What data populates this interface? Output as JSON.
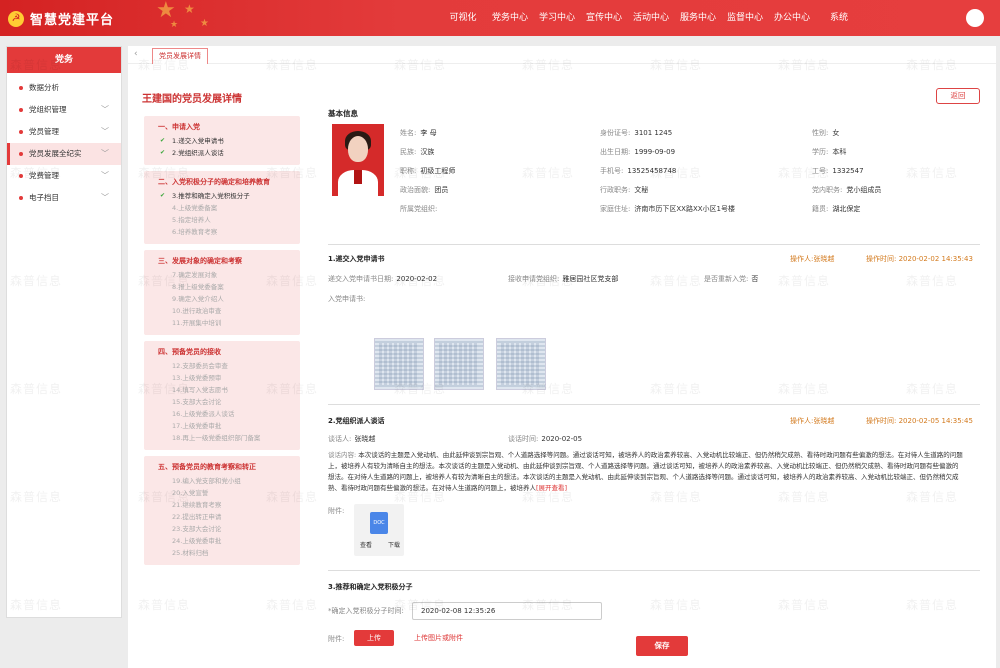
{
  "brand": {
    "title": "智慧党建平台"
  },
  "nav": [
    "可视化",
    "党务中心",
    "学习中心",
    "宣传中心",
    "活动中心",
    "服务中心",
    "监督中心",
    "办公中心",
    "系统"
  ],
  "sidebar": {
    "header": "党务",
    "items": [
      {
        "label": "数据分析",
        "active": false
      },
      {
        "label": "党组织管理",
        "active": false
      },
      {
        "label": "党员管理",
        "active": false
      },
      {
        "label": "党员发展全纪实",
        "active": true
      },
      {
        "label": "党费管理",
        "active": false
      },
      {
        "label": "电子档目",
        "active": false
      }
    ]
  },
  "tab": {
    "label": "党员发展详情"
  },
  "page": {
    "title": "王建国的党员发展详情",
    "back_label": "返回"
  },
  "steps": [
    {
      "title": "一、申请入党",
      "items": [
        {
          "label": "1.递交入党申请书",
          "done": true
        },
        {
          "label": "2.党组织派人谈话",
          "done": true
        }
      ]
    },
    {
      "title": "二、入党积极分子的确定和培养教育",
      "items": [
        {
          "label": "3.推荐和确定入党积极分子",
          "done": true
        },
        {
          "label": "4.上级党委备案",
          "done": false
        },
        {
          "label": "5.指定培养人",
          "done": false
        },
        {
          "label": "6.培养教育考察",
          "done": false
        }
      ]
    },
    {
      "title": "三、发展对象的确定和考察",
      "items": [
        {
          "label": "7.确定发展对象",
          "done": false
        },
        {
          "label": "8.报上级党委备案",
          "done": false
        },
        {
          "label": "9.确定入党介绍人",
          "done": false
        },
        {
          "label": "10.进行政治审查",
          "done": false
        },
        {
          "label": "11.开展集中培训",
          "done": false
        }
      ]
    },
    {
      "title": "四、预备党员的接收",
      "items": [
        {
          "label": "12.支部委员会审查",
          "done": false
        },
        {
          "label": "13.上级党委预审",
          "done": false
        },
        {
          "label": "14.填写入党志愿书",
          "done": false
        },
        {
          "label": "15.支部大会讨论",
          "done": false
        },
        {
          "label": "16.上级党委派人谈话",
          "done": false
        },
        {
          "label": "17.上级党委审批",
          "done": false
        },
        {
          "label": "18.再上一级党委组织部门备案",
          "done": false
        }
      ]
    },
    {
      "title": "五、预备党员的教育考察和转正",
      "items": [
        {
          "label": "19.编入党支部和党小组",
          "done": false
        },
        {
          "label": "20.入党宣誓",
          "done": false
        },
        {
          "label": "21.继续教育考察",
          "done": false
        },
        {
          "label": "22.提出转正申请",
          "done": false
        },
        {
          "label": "23.支部大会讨论",
          "done": false
        },
        {
          "label": "24.上级党委审批",
          "done": false
        },
        {
          "label": "25.材料归档",
          "done": false
        }
      ]
    }
  ],
  "basic": {
    "title": "基本信息",
    "rows": [
      [
        {
          "k": "姓名:",
          "v": "李 ⺟"
        },
        {
          "k": "身份证号:",
          "v": "3101           1245"
        },
        {
          "k": "性别:",
          "v": "女"
        }
      ],
      [
        {
          "k": "民族:",
          "v": "汉族"
        },
        {
          "k": "出生日期:",
          "v": "1999-09-09"
        },
        {
          "k": "学历:",
          "v": "本科"
        }
      ],
      [
        {
          "k": "职称:",
          "v": "初级工程师"
        },
        {
          "k": "手机号:",
          "v": "13525458748"
        },
        {
          "k": "工号:",
          "v": "1332547"
        }
      ],
      [
        {
          "k": "政治面貌:",
          "v": "团员"
        },
        {
          "k": "行政职务:",
          "v": "文秘"
        },
        {
          "k": "党内职务:",
          "v": "党小组成员"
        }
      ],
      [
        {
          "k": "所属党组织:",
          "v": ""
        },
        {
          "k": "家庭住址:",
          "v": "济南市历下区XX路XX小区1号楼"
        },
        {
          "k": "籍贯:",
          "v": "湖北保定"
        }
      ]
    ]
  },
  "step1": {
    "title": "1.递交入党申请书",
    "operator_k": "操作人:",
    "operator_v": "张晓越",
    "time_k": "操作时间:",
    "time_v": "2020-02-02  14:35:43",
    "date_k": "递交入党申请书日期:",
    "date_v": "2020-02-02",
    "org_k": "接收申请党组织:",
    "org_v": "雅居园社区党支部",
    "reapply_k": "是否重新入党:",
    "reapply_v": "否",
    "letter_k": "入党申请书:"
  },
  "step2": {
    "title": "2.党组织派人谈话",
    "operator_k": "操作人:",
    "operator_v": "张晓越",
    "time_k": "操作时间:",
    "time_v": "2020-02-05  14:35:45",
    "talker_k": "谈话人:",
    "talker_v": "张晓越",
    "talk_time_k": "谈话时间:",
    "talk_time_v": "2020-02-05",
    "content_k": "谈话内容:",
    "content_v": "本次谈话的主题是入党动机、由此延伸谈到宗旨观、个人道路选择等问题。通过谈话可知，被培养人的政治素养较高、入党动机比较端正、但仍然稍欠成熟、看待时政问题有些偏激的想法。在对待人生道路的问题上，被培养人有较为清晰自主的想法。本次谈话的主题是入党动机、由此延伸谈到宗旨观、个人道路选择等问题。通过谈话可知，被培养人的政治素养较高、入党动机比较端正、但仍然稍欠成熟、看待时政问题有些偏激的想法。在对待人生道路的问题上，被培养人有较为清晰自主的想法。本次谈话的主题是入党动机、由此延伸谈到宗旨观、个人道路选择等问题。通过谈话可知，被培养人的政治素养较高、入党动机比较端正、但仍然稍欠成熟、看待时政问题有些偏激的想法。在对待人生道路的问题上，被培养人",
    "more": "[展开查看]",
    "attach_k": "附件:",
    "file_icon": "DOC",
    "view": "查看",
    "download": "下载"
  },
  "step3": {
    "title": "3.推荐和确定入党积极分子",
    "time_label": "*确定入党积极分子时间:",
    "time_value": "2020-02-08   12:35:26",
    "attach_k": "附件:",
    "upload": "上传",
    "upload_hint": "上传图片或附件"
  },
  "save": "保存",
  "watermark": "森普信息"
}
